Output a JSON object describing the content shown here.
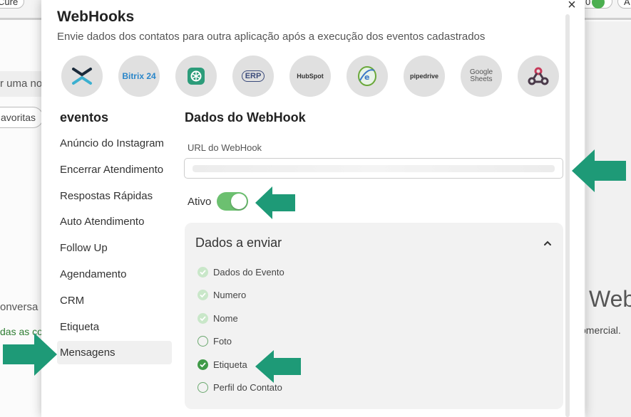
{
  "background": {
    "top_pills": [
      "Cure",
      "0",
      "A"
    ],
    "search_text": "r uma no",
    "favorites_label": "avoritas",
    "conversa_text": "onversa",
    "green_text": "das as co",
    "web_text": "Web",
    "comercial_text": "omercial."
  },
  "modal": {
    "title": "WebHooks",
    "subtitle": "Envie dados dos contatos para outra aplicação após a execução dos eventos cadastrados",
    "close_label": "×",
    "integrations": [
      {
        "name": "xlogo",
        "label": ""
      },
      {
        "name": "bitrix24",
        "label": "Bitrix 24"
      },
      {
        "name": "chatgpt",
        "label": ""
      },
      {
        "name": "erp",
        "label": "ERP"
      },
      {
        "name": "hubspot",
        "label": "HubSpot"
      },
      {
        "name": "nfe",
        "label": "NF-e"
      },
      {
        "name": "pipedrive",
        "label": "pipedrive"
      },
      {
        "name": "google-sheets",
        "label": "Google Sheets"
      },
      {
        "name": "webhook",
        "label": ""
      }
    ],
    "events_title": "eventos",
    "events": [
      "Anúncio do Instagram",
      "Encerrar Atendimento",
      "Respostas Rápidas",
      "Auto Atendimento",
      "Follow Up",
      "Agendamento",
      "CRM",
      "Etiqueta",
      "Mensagens"
    ],
    "active_event": "Mensagens",
    "form": {
      "title": "Dados do WebHook",
      "url_label": "URL do WebHook",
      "url_value": "",
      "ativo_label": "Ativo",
      "ativo_on": true
    },
    "panel": {
      "title": "Dados a enviar",
      "fields": [
        {
          "label": "Dados do Evento",
          "state": "disabled"
        },
        {
          "label": "Numero",
          "state": "disabled"
        },
        {
          "label": "Nome",
          "state": "disabled"
        },
        {
          "label": "Foto",
          "state": "off"
        },
        {
          "label": "Etiqueta",
          "state": "on"
        },
        {
          "label": "Perfil do Contato",
          "state": "off"
        }
      ]
    }
  },
  "colors": {
    "toggle_on": "#6cc070",
    "check_on": "#3f9a47",
    "annotation_arrow": "#1e9a77"
  }
}
